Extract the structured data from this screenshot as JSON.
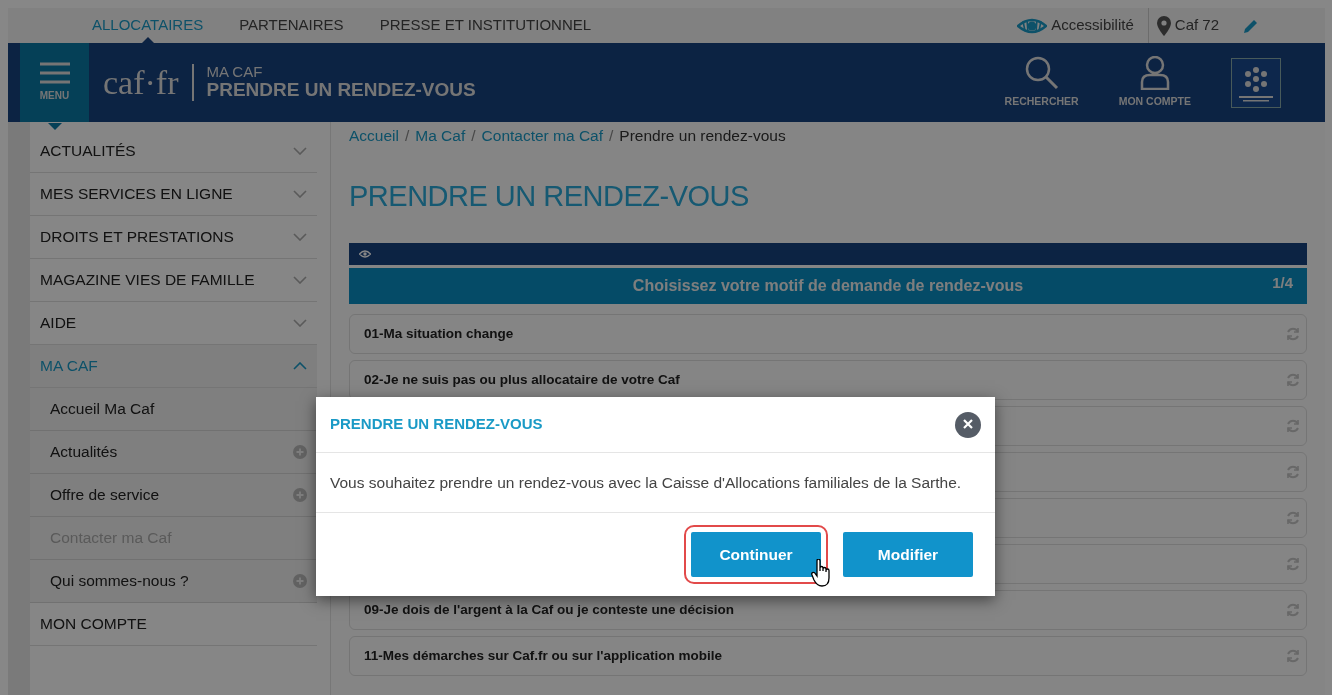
{
  "top_nav": [
    {
      "label": "ALLOCATAIRES",
      "selected": true
    },
    {
      "label": "PARTENAIRES",
      "selected": false
    },
    {
      "label": "PRESSE ET INSTITUTIONNEL",
      "selected": false
    }
  ],
  "top_links": {
    "accessibility": "Accessibilité",
    "location": "Caf 72"
  },
  "header": {
    "menu_label": "MENU",
    "logo": "caf·fr",
    "section": "MA CAF",
    "page_title": "PRENDRE UN RENDEZ-VOUS",
    "search_label": "RECHERCHER",
    "account_label": "MON COMPTE"
  },
  "sidebar": {
    "items": [
      {
        "label": "ACTUALITÉS",
        "selected": false,
        "expanded": false
      },
      {
        "label": "MES SERVICES EN LIGNE",
        "selected": false,
        "expanded": false
      },
      {
        "label": "DROITS ET PRESTATIONS",
        "selected": false,
        "expanded": false
      },
      {
        "label": "MAGAZINE VIES DE FAMILLE",
        "selected": false,
        "expanded": false
      },
      {
        "label": "AIDE",
        "selected": false,
        "expanded": false
      },
      {
        "label": "MA CAF",
        "selected": true,
        "expanded": true,
        "children": [
          {
            "label": "Accueil Ma Caf",
            "selected": false,
            "expandable": false
          },
          {
            "label": "Actualités",
            "selected": false,
            "expandable": true
          },
          {
            "label": "Offre de service",
            "selected": false,
            "expandable": true
          },
          {
            "label": "Contacter ma Caf",
            "selected": true,
            "expandable": false
          },
          {
            "label": "Qui sommes-nous ?",
            "selected": false,
            "expandable": true
          }
        ]
      },
      {
        "label": "MON COMPTE",
        "selected": false
      }
    ]
  },
  "breadcrumb": [
    {
      "label": "Accueil",
      "separator": "/"
    },
    {
      "label": "Ma Caf",
      "separator": "/"
    },
    {
      "label": "Contacter ma Caf",
      "separator": "/"
    },
    {
      "label": "Prendre un rendez-vous"
    }
  ],
  "title": "PRENDRE UN RENDEZ-VOUS",
  "form": {
    "heading": "Choisissez votre motif de demande de rendez-vous",
    "step": "1/4",
    "rows": [
      {
        "kind": "reason",
        "label": "01-Ma situation change"
      },
      {
        "kind": "reason",
        "label": "02-Je ne suis pas ou plus allocataire de votre Caf"
      },
      {
        "kind": "covered"
      },
      {
        "kind": "covered"
      },
      {
        "kind": "covered"
      },
      {
        "kind": "covered"
      },
      {
        "kind": "reason",
        "label": "09-Je dois de l'argent à la Caf ou je conteste une décision"
      },
      {
        "kind": "reason",
        "label": "11-Mes démarches sur Caf.fr ou sur l'application mobile"
      }
    ]
  },
  "modal": {
    "title": "PRENDRE UN RENDEZ-VOUS",
    "message": "Vous souhaitez prendre un rendez-vous avec la Caisse d'Allocations familiales de la Sarthe.",
    "buttons": [
      {
        "label": "Continuer",
        "highlighted": true
      },
      {
        "label": "Modifier",
        "highlighted": false
      }
    ]
  }
}
